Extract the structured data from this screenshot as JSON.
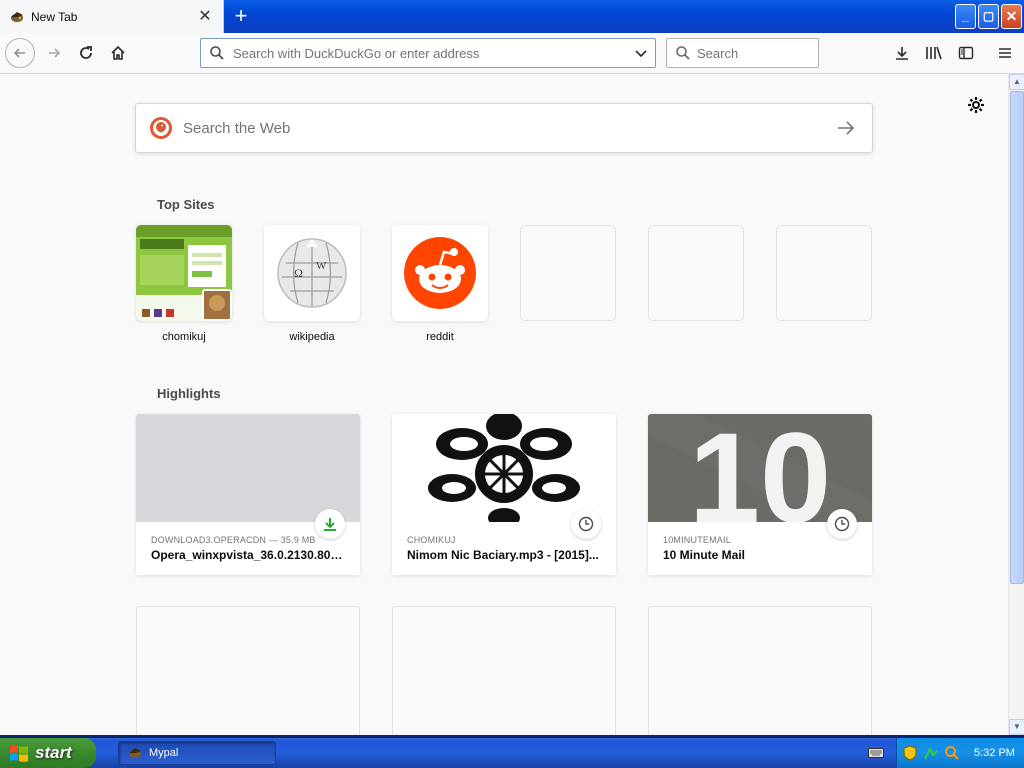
{
  "window": {
    "tab_title": "New Tab",
    "minimize": "_",
    "maximize": "▢",
    "close": "✕"
  },
  "toolbar": {
    "url_placeholder": "Search with DuckDuckGo or enter address",
    "search_placeholder": "Search"
  },
  "newtab": {
    "search_placeholder": "Search the Web",
    "topsites_title": "Top Sites",
    "highlights_title": "Highlights",
    "topsites": [
      {
        "label": "chomikuj"
      },
      {
        "label": "wikipedia"
      },
      {
        "label": "reddit"
      }
    ],
    "highlights": [
      {
        "context": "DOWNLOAD3.OPERACDN — 35.9 MB",
        "title": "Opera_winxpvista_36.0.2130.80_...",
        "badge": "download-icon"
      },
      {
        "context": "CHOMIKUJ",
        "title": "Nimom Nic Baciary.mp3 - [2015]...",
        "badge": "clock-icon"
      },
      {
        "context": "10MINUTEMAIL",
        "title": "10 Minute Mail",
        "badge": "clock-icon"
      }
    ],
    "highlight_thumb_text": "10"
  },
  "taskbar": {
    "start_label": "start",
    "task_label": "Mypal",
    "clock": "5:32 PM"
  },
  "colors": {
    "reddit": "#ff4500",
    "download_green": "#2ea538",
    "titlebar_blue": "#0246d6"
  }
}
